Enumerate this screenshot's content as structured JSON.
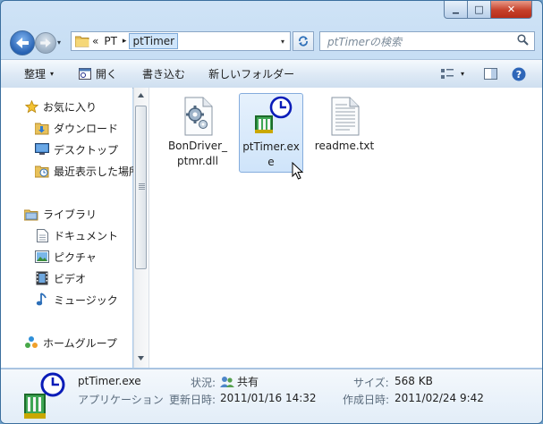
{
  "window": {
    "minimize_glyph": "▁",
    "maximize_glyph": "□",
    "close_glyph": "✕"
  },
  "address": {
    "recent_glyph": "▾",
    "overflow": "«",
    "crumbs": [
      "PT",
      "ptTimer"
    ],
    "separator": "▸",
    "dropdown_glyph": "▾",
    "refresh_icon": "refresh-icon"
  },
  "search": {
    "placeholder": "ptTimerの検索"
  },
  "toolbar": {
    "organize": "整理",
    "open": "開く",
    "burn": "書き込む",
    "new_folder": "新しいフォルダー",
    "dropdown_glyph": "▾"
  },
  "nav": {
    "favorites": "お気に入り",
    "downloads": "ダウンロード",
    "desktop": "デスクトップ",
    "recent": "最近表示した場所",
    "libraries": "ライブラリ",
    "documents": "ドキュメント",
    "pictures": "ピクチャ",
    "videos": "ビデオ",
    "music": "ミュージック",
    "homegroup": "ホームグループ"
  },
  "files": [
    {
      "name": "BonDriver_ptmr.dll",
      "icon": "dll-gear-icon"
    },
    {
      "name": "ptTimer.exe",
      "icon": "clock-app-icon"
    },
    {
      "name": "readme.txt",
      "icon": "text-file-icon"
    }
  ],
  "details": {
    "name": "ptTimer.exe",
    "type": "アプリケーション",
    "status_label": "状況:",
    "status_value": "共有",
    "modified_label": "更新日時:",
    "modified_value": "2011/01/16 14:32",
    "size_label": "サイズ:",
    "size_value": "568 KB",
    "created_label": "作成日時:",
    "created_value": "2011/02/24 9:42"
  },
  "colors": {
    "accent": "#3a6ea5",
    "selection": "#cfe4fa",
    "close_red": "#c6402a"
  }
}
